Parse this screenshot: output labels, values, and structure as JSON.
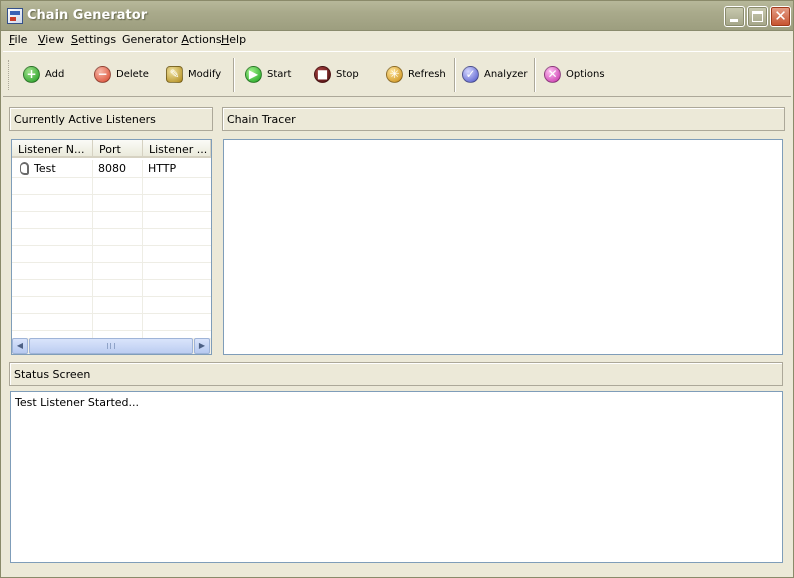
{
  "window": {
    "title": "Chain Generator"
  },
  "menu": {
    "items": [
      {
        "label": "File",
        "mnemonic": "F",
        "rest": "ile"
      },
      {
        "label": "View",
        "mnemonic": "V",
        "rest": "iew"
      },
      {
        "label": "Settings",
        "mnemonic": "S",
        "rest": "ettings"
      },
      {
        "label": "Generator Actions",
        "prefix": "Generator ",
        "mnemonic": "A",
        "rest": "ctions"
      },
      {
        "label": "Help",
        "mnemonic": "H",
        "rest": "elp"
      }
    ]
  },
  "toolbar": {
    "add": "Add",
    "delete": "Delete",
    "modify": "Modify",
    "start": "Start",
    "stop": "Stop",
    "refresh": "Refresh",
    "analyzer": "Analyzer",
    "options": "Options"
  },
  "listeners": {
    "header": "Currently Active Listeners",
    "columns": [
      "Listener N...",
      "Port",
      "Listener ..."
    ],
    "rows": [
      {
        "name": "Test",
        "port": "8080",
        "type": "HTTP"
      }
    ]
  },
  "chain_tracer": {
    "header": "Chain Tracer"
  },
  "status": {
    "header": "Status Screen",
    "text": "Test Listener Started..."
  }
}
